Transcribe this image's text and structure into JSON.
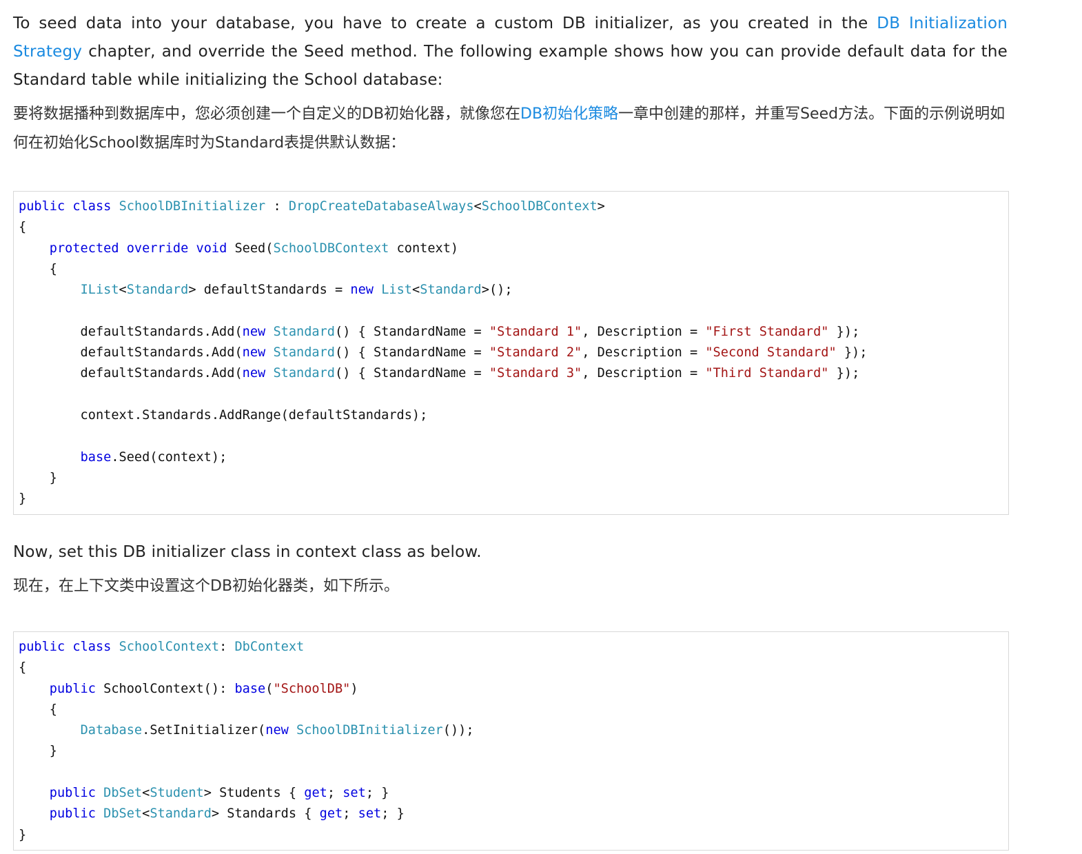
{
  "intro": {
    "en_before_link": "To seed data into your database, you have to create a custom DB initializer, as you created in the ",
    "en_link": "DB Initialization Strategy",
    "en_after_link": " chapter, and override the Seed method. The following example shows how you can provide default data for the Standard table while initializing the School database:",
    "zh_before_link": "要将数据播种到数据库中，您必须创建一个自定义的DB初始化器，就像您在",
    "zh_link": "DB初始化策略",
    "zh_after_link": "一章中创建的那样，并重写Seed方法。下面的示例说明如何在初始化School数据库时为Standard表提供默认数据："
  },
  "code_block_1": [
    [
      [
        "kw",
        "public"
      ],
      [
        "p",
        " "
      ],
      [
        "kw",
        "class"
      ],
      [
        "p",
        " "
      ],
      [
        "ty",
        "SchoolDBInitializer"
      ],
      [
        "p",
        " : "
      ],
      [
        "ty",
        "DropCreateDatabaseAlways"
      ],
      [
        "p",
        "<"
      ],
      [
        "ty",
        "SchoolDBContext"
      ],
      [
        "p",
        ">"
      ]
    ],
    [
      [
        "p",
        "{"
      ]
    ],
    [
      [
        "p",
        "    "
      ],
      [
        "kw",
        "protected"
      ],
      [
        "p",
        " "
      ],
      [
        "kw",
        "override"
      ],
      [
        "p",
        " "
      ],
      [
        "kw",
        "void"
      ],
      [
        "p",
        " Seed("
      ],
      [
        "ty",
        "SchoolDBContext"
      ],
      [
        "p",
        " context)"
      ]
    ],
    [
      [
        "p",
        "    {"
      ]
    ],
    [
      [
        "p",
        "        "
      ],
      [
        "ty",
        "IList"
      ],
      [
        "p",
        "<"
      ],
      [
        "ty",
        "Standard"
      ],
      [
        "p",
        "> defaultStandards = "
      ],
      [
        "kw",
        "new"
      ],
      [
        "p",
        " "
      ],
      [
        "ty",
        "List"
      ],
      [
        "p",
        "<"
      ],
      [
        "ty",
        "Standard"
      ],
      [
        "p",
        ">();"
      ]
    ],
    [
      [
        "p",
        ""
      ]
    ],
    [
      [
        "p",
        "        defaultStandards.Add("
      ],
      [
        "kw",
        "new"
      ],
      [
        "p",
        " "
      ],
      [
        "ty",
        "Standard"
      ],
      [
        "p",
        "() { StandardName = "
      ],
      [
        "st",
        "\"Standard 1\""
      ],
      [
        "p",
        ", Description = "
      ],
      [
        "st",
        "\"First Standard\""
      ],
      [
        "p",
        " });"
      ]
    ],
    [
      [
        "p",
        "        defaultStandards.Add("
      ],
      [
        "kw",
        "new"
      ],
      [
        "p",
        " "
      ],
      [
        "ty",
        "Standard"
      ],
      [
        "p",
        "() { StandardName = "
      ],
      [
        "st",
        "\"Standard 2\""
      ],
      [
        "p",
        ", Description = "
      ],
      [
        "st",
        "\"Second Standard\""
      ],
      [
        "p",
        " });"
      ]
    ],
    [
      [
        "p",
        "        defaultStandards.Add("
      ],
      [
        "kw",
        "new"
      ],
      [
        "p",
        " "
      ],
      [
        "ty",
        "Standard"
      ],
      [
        "p",
        "() { StandardName = "
      ],
      [
        "st",
        "\"Standard 3\""
      ],
      [
        "p",
        ", Description = "
      ],
      [
        "st",
        "\"Third Standard\""
      ],
      [
        "p",
        " });"
      ]
    ],
    [
      [
        "p",
        ""
      ]
    ],
    [
      [
        "p",
        "        context.Standards.AddRange(defaultStandards);"
      ]
    ],
    [
      [
        "p",
        ""
      ]
    ],
    [
      [
        "p",
        "        "
      ],
      [
        "kw",
        "base"
      ],
      [
        "p",
        ".Seed(context);"
      ]
    ],
    [
      [
        "p",
        "    }"
      ]
    ],
    [
      [
        "p",
        "}"
      ]
    ]
  ],
  "now": {
    "en": "Now, set this DB initializer class in context class as below.",
    "zh": "现在，在上下文类中设置这个DB初始化器类，如下所示。"
  },
  "code_block_2": [
    [
      [
        "kw",
        "public"
      ],
      [
        "p",
        " "
      ],
      [
        "kw",
        "class"
      ],
      [
        "p",
        " "
      ],
      [
        "ty",
        "SchoolContext"
      ],
      [
        "p",
        ": "
      ],
      [
        "ty",
        "DbContext"
      ]
    ],
    [
      [
        "p",
        "{"
      ]
    ],
    [
      [
        "p",
        "    "
      ],
      [
        "kw",
        "public"
      ],
      [
        "p",
        " SchoolContext(): "
      ],
      [
        "kw",
        "base"
      ],
      [
        "p",
        "("
      ],
      [
        "st",
        "\"SchoolDB\""
      ],
      [
        "p",
        ")"
      ]
    ],
    [
      [
        "p",
        "    {"
      ]
    ],
    [
      [
        "p",
        "        "
      ],
      [
        "ty",
        "Database"
      ],
      [
        "p",
        ".SetInitializer("
      ],
      [
        "kw",
        "new"
      ],
      [
        "p",
        " "
      ],
      [
        "ty",
        "SchoolDBInitializer"
      ],
      [
        "p",
        "());"
      ]
    ],
    [
      [
        "p",
        "    }"
      ]
    ],
    [
      [
        "p",
        ""
      ]
    ],
    [
      [
        "p",
        "    "
      ],
      [
        "kw",
        "public"
      ],
      [
        "p",
        " "
      ],
      [
        "ty",
        "DbSet"
      ],
      [
        "p",
        "<"
      ],
      [
        "ty",
        "Student"
      ],
      [
        "p",
        "> Students { "
      ],
      [
        "kw",
        "get"
      ],
      [
        "p",
        "; "
      ],
      [
        "kw",
        "set"
      ],
      [
        "p",
        "; }"
      ]
    ],
    [
      [
        "p",
        "    "
      ],
      [
        "kw",
        "public"
      ],
      [
        "p",
        " "
      ],
      [
        "ty",
        "DbSet"
      ],
      [
        "p",
        "<"
      ],
      [
        "ty",
        "Standard"
      ],
      [
        "p",
        "> Standards { "
      ],
      [
        "kw",
        "get"
      ],
      [
        "p",
        "; "
      ],
      [
        "kw",
        "set"
      ],
      [
        "p",
        "; }"
      ]
    ],
    [
      [
        "p",
        "}"
      ]
    ]
  ]
}
